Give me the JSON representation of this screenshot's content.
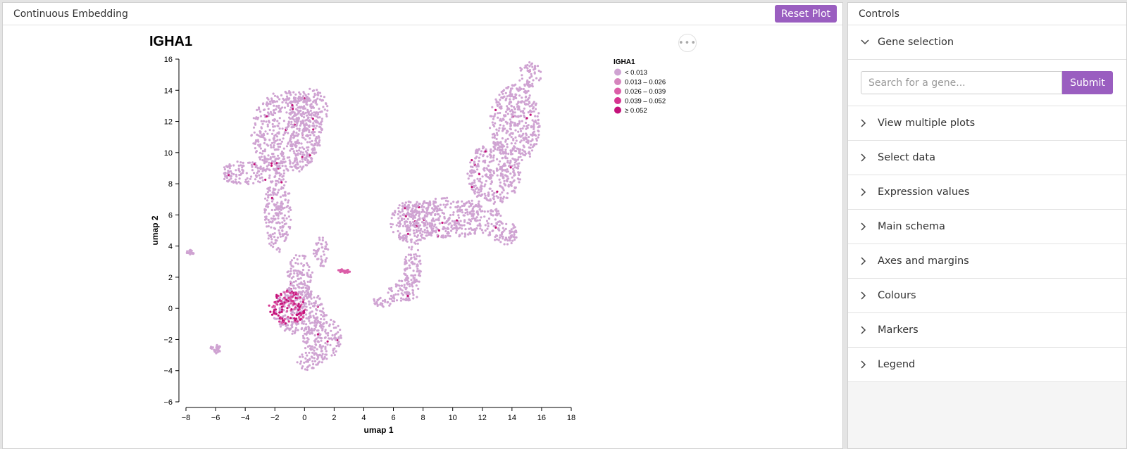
{
  "left_panel": {
    "title": "Continuous Embedding",
    "reset_label": "Reset Plot"
  },
  "plot": {
    "title": "IGHA1",
    "more_glyph": "•••"
  },
  "chart_data": {
    "type": "scatter",
    "title": "IGHA1",
    "xlabel": "umap 1",
    "ylabel": "umap 2",
    "xlim": [
      -8,
      18
    ],
    "ylim": [
      -6,
      16
    ],
    "xticks": [
      -8,
      -6,
      -4,
      -2,
      0,
      2,
      4,
      6,
      8,
      10,
      12,
      14,
      16,
      18
    ],
    "yticks": [
      -6,
      -4,
      -2,
      0,
      2,
      4,
      6,
      8,
      10,
      12,
      14,
      16
    ],
    "grid": false,
    "legend": {
      "title": "IGHA1",
      "placement": "top-right",
      "bins": [
        {
          "label": "< 0.013",
          "color": "#cfa3d2"
        },
        {
          "label": "0.013 – 0.026",
          "color": "#d585bd"
        },
        {
          "label": "0.026 – 0.039",
          "color": "#db5ea8"
        },
        {
          "label": "0.039 – 0.052",
          "color": "#d63491"
        },
        {
          "label": "≥ 0.052",
          "color": "#c4127a"
        }
      ]
    },
    "regions": [
      {
        "name": "top-left cluster",
        "cx": -1.2,
        "cy": 11.3,
        "rx": 2.4,
        "ry": 2.7,
        "bin": 0
      },
      {
        "name": "top-left lobe",
        "cx": 0.3,
        "cy": 12.8,
        "rx": 1.3,
        "ry": 1.4,
        "bin": 0
      },
      {
        "name": "left arm",
        "cx": -4.0,
        "cy": 8.7,
        "rx": 1.8,
        "ry": 0.75,
        "bin": 0
      },
      {
        "name": "left stalk",
        "cx": -1.8,
        "cy": 6.2,
        "rx": 0.9,
        "ry": 2.7,
        "bin": 0
      },
      {
        "name": "central stalk",
        "cx": -0.3,
        "cy": 1.8,
        "rx": 0.9,
        "ry": 1.7,
        "bin": 0
      },
      {
        "name": "central mass",
        "cx": -0.4,
        "cy": -0.2,
        "rx": 1.7,
        "ry": 1.6,
        "bin": 0
      },
      {
        "name": "lower mass",
        "cx": 1.2,
        "cy": -1.9,
        "rx": 1.3,
        "ry": 1.5,
        "bin": 0
      },
      {
        "name": "lower tail",
        "cx": 0.4,
        "cy": -3.4,
        "rx": 0.9,
        "ry": 0.6,
        "bin": 0
      },
      {
        "name": "small right arm",
        "cx": 1.1,
        "cy": 3.6,
        "rx": 0.5,
        "ry": 1.0,
        "bin": 0
      },
      {
        "name": "central dense IGHA1+",
        "cx": -1.1,
        "cy": 0.1,
        "rx": 1.3,
        "ry": 1.1,
        "bin": 3
      },
      {
        "name": "right cluster lower",
        "cx": 9.9,
        "cy": 5.8,
        "rx": 3.4,
        "ry": 1.3,
        "bin": 0
      },
      {
        "name": "right cluster mid",
        "cx": 12.8,
        "cy": 8.7,
        "rx": 1.8,
        "ry": 2.0,
        "bin": 0
      },
      {
        "name": "right upper arm",
        "cx": 14.2,
        "cy": 11.8,
        "rx": 1.7,
        "ry": 2.6,
        "bin": 0
      },
      {
        "name": "right top tip",
        "cx": 15.2,
        "cy": 15.0,
        "rx": 0.8,
        "ry": 0.8,
        "bin": 0
      },
      {
        "name": "right left lobe",
        "cx": 7.3,
        "cy": 5.5,
        "rx": 1.5,
        "ry": 1.4,
        "bin": 0
      },
      {
        "name": "right bottom lobe",
        "cx": 13.4,
        "cy": 4.8,
        "rx": 1.0,
        "ry": 0.8,
        "bin": 0
      },
      {
        "name": "right stalk",
        "cx": 7.3,
        "cy": 2.6,
        "rx": 0.6,
        "ry": 1.5,
        "bin": 0
      },
      {
        "name": "right foot",
        "cx": 6.7,
        "cy": 1.1,
        "rx": 1.1,
        "ry": 0.7,
        "bin": 0
      },
      {
        "name": "right foot tail",
        "cx": 5.3,
        "cy": 0.4,
        "rx": 0.8,
        "ry": 0.3,
        "bin": 0
      },
      {
        "name": "far left blob",
        "cx": -7.7,
        "cy": 3.6,
        "rx": 0.25,
        "ry": 0.15,
        "bin": 0
      },
      {
        "name": "bottom-left streak",
        "cx": -6.0,
        "cy": -2.6,
        "rx": 0.35,
        "ry": 0.3,
        "bin": 0
      },
      {
        "name": "small right streak",
        "cx": 2.7,
        "cy": 2.4,
        "rx": 0.45,
        "ry": 0.12,
        "bin": 2
      }
    ]
  },
  "controls": {
    "title": "Controls",
    "gene_selection_label": "Gene selection",
    "search_placeholder": "Search for a gene...",
    "submit_label": "Submit",
    "items": [
      "View multiple plots",
      "Select data",
      "Expression values",
      "Main schema",
      "Axes and margins",
      "Colours",
      "Markers",
      "Legend"
    ]
  }
}
